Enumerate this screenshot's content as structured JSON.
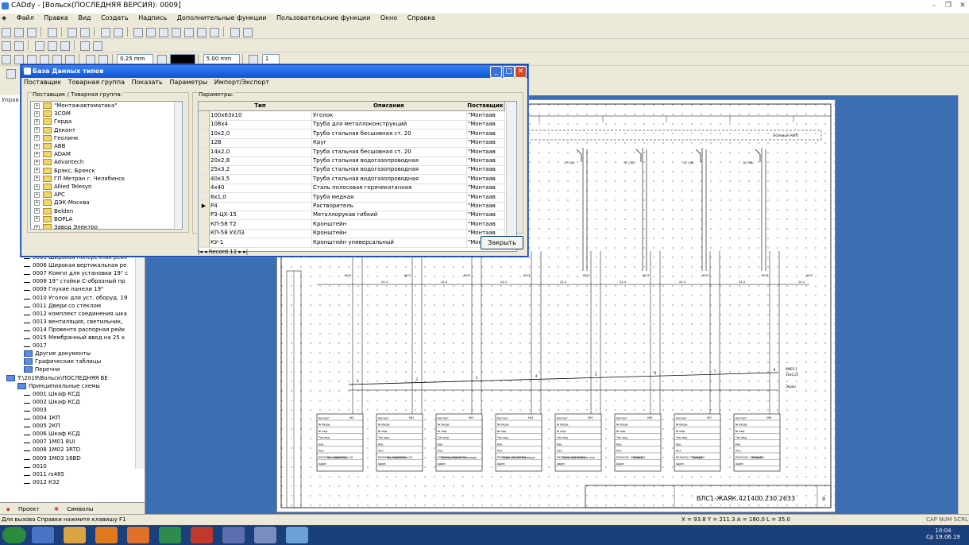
{
  "window": {
    "title": "CADdy - [Вольск(ПОСЛЕДНЯЯ ВЕРСИЯ): 0009]"
  },
  "menu": [
    "Файл",
    "Правка",
    "Вид",
    "Создать",
    "Надпись",
    "Дополнительные функции",
    "Пользовательские функции",
    "Окно",
    "Справка"
  ],
  "toolbar": {
    "line_width": "0.25 mm",
    "grid_step": "5.00 mm",
    "layer": "1"
  },
  "left_panel": {
    "title": "Управ",
    "items": [
      "0005   Широкая поперечная рейк",
      "0006   Широкая вертикальная ре",
      "0007   Компл для установки 19\" с",
      "0008   19\" стойки С-образный пр",
      "0009   Глухие панели 19\"",
      "0010   Уголок для уст. оборуд. 19",
      "0011   Двери со стеклом",
      "0012   комплект соединения шка",
      "0013   вентиляция, светильник,",
      "0014   Провенто распорная рейк",
      "0015   Мембранный ввод на 25 к",
      "0017"
    ],
    "folders": [
      "Другие документы",
      "Графические таблицы",
      "Перечни"
    ],
    "project_path": "T:\\2019\\Вольск\\ПОСЛЕДНЯЯ ВЕ",
    "schemes_label": "Принципиальные схемы",
    "schemes": [
      "0001   Шкаф КСД",
      "0002   Шкаф КСД",
      "0003",
      "0004   1КП",
      "0005   2КП",
      "0006   Шкаф КСД",
      "0007   1М01   8UI",
      "0008   1М02   3RTD",
      "0009   1М03   16BD",
      "0010",
      "0011   rs485",
      "0012   К32"
    ],
    "tabs": [
      "Проект",
      "Символы"
    ]
  },
  "dialog": {
    "title": "База Данных типов",
    "menu": [
      "Поставщик",
      "Товарная группа",
      "Показать",
      "Параметры",
      "Импорт/Экспорт"
    ],
    "group_left_label": "Поставщик / Товарная группа:",
    "suppliers": [
      "\"Монтажавтоматика\"",
      "3СОМ",
      "Герда",
      "Деконт",
      "Геолинк",
      "ABB",
      "ADAM",
      "Advantech",
      "Брэкс, Брянск",
      "ГП Метран г. Челябинск",
      "Allied Telesyn",
      "APC",
      "ДЭК-Москва",
      "Belden",
      "BOPLA",
      "Завод Электро"
    ],
    "group_right_label": "Параметры:",
    "columns": [
      "Тип",
      "Описание",
      "Поставщик"
    ],
    "rows": [
      [
        "100x63x10",
        "Уголок",
        "\"Монтаав"
      ],
      [
        "108x4",
        "Труба для металлоконструкций",
        "\"Монтаав"
      ],
      [
        "10x2,0",
        "Труба стальная бесшовная ст. 20",
        "\"Монтаав"
      ],
      [
        "12В",
        "Круг",
        "\"Монтаав"
      ],
      [
        "14x2,0",
        "Труба стальная бесшовная ст. 20",
        "\"Монтаав"
      ],
      [
        "20x2,8",
        "Труба стальная водогазопроводная",
        "\"Монтаав"
      ],
      [
        "25x3,2",
        "Труба стальная водогазопроводная",
        "\"Монтаав"
      ],
      [
        "40x3,5",
        "Труба стальная водогазопроводная",
        "\"Монтаав"
      ],
      [
        "4x40",
        "Сталь полосовая горячекатанная",
        "\"Монтаав"
      ],
      [
        "8x1,0",
        "Труба медная",
        "\"Монтаав"
      ],
      [
        "Р4",
        "Растворитель",
        "\"Монтаав"
      ],
      [
        "Р3-ЦХ-15",
        "Металлорукав гибкий",
        "\"Монтаав"
      ],
      [
        "КП-58 Т2",
        "Кронштейн",
        "\"Монтаав"
      ],
      [
        "КП-58 УХЛ3",
        "Кронштейн",
        "\"Монтаав"
      ],
      [
        "КУ-1",
        "Кронштейн универсальный",
        "\"Мон"
      ]
    ],
    "current_row": 10,
    "record_label": "Record",
    "record_value": "11",
    "close_label": "Закрыть"
  },
  "drawing": {
    "header_box_label": "Полевые КИП",
    "breakers": [
      "QF (0В)",
      "QF (0В)",
      "QF (0В)",
      "QF (0В)"
    ],
    "bus_labels": [
      "НЮ3",
      "НЮ3",
      "НЮ3",
      "НЮ3",
      "НЮ3",
      "НЮ3",
      "НЮ3",
      "НЮ3",
      "НЮ3"
    ],
    "wire_labels": [
      "24-4",
      "24-4",
      "24-4",
      "24-4",
      "24-4",
      "24-4",
      "24-4",
      "24-4"
    ],
    "cable_numbers": [
      "1",
      "2",
      "3",
      "4",
      "5",
      "6",
      "7",
      "8"
    ],
    "cable_tag": "9М03-1",
    "cable_spec": "16x0,25",
    "cable_label": "Экран",
    "terminal_blocks": [
      {
        "id": "ХК1",
        "title": "Загазованность СО"
      },
      {
        "id": "ХК2",
        "title": "Загазованность СО"
      },
      {
        "id": "ХК3",
        "title": "Возгорание сигнализация"
      },
      {
        "id": "ХК4",
        "title": "Охранная сигнализация"
      },
      {
        "id": "ХК5",
        "title": "Состояние клапана газа"
      },
      {
        "id": "ХК6",
        "title": "Резерв"
      },
      {
        "id": "ХК7",
        "title": "Резерв"
      },
      {
        "id": "ХК8",
        "title": "Резерв"
      }
    ],
    "block_rows": [
      "Контакт",
      "№ Входа",
      "№ мод.",
      "Тип мод.",
      "Кан.",
      "Пол.",
      "Назначен. параметра",
      "Адрес"
    ],
    "stamp_code": "ВЛС1-ЖАЯК.421400.230.2633",
    "sheet_number": "9"
  },
  "status": {
    "hint": "Для вызова Справки нажмите клавишу F1",
    "coords": "X = 93.8  Y = 211.3  A = 180.0  L = 35.0",
    "indicators": "CAP  NUM  SCRL"
  },
  "taskbar": {
    "time": "10:04",
    "date": "Ср 19.06.19"
  },
  "colors": {
    "dialog_title": "#0a55d8",
    "canvas_bg": "#3c6eb4",
    "taskbar": "#1b3f7a"
  }
}
